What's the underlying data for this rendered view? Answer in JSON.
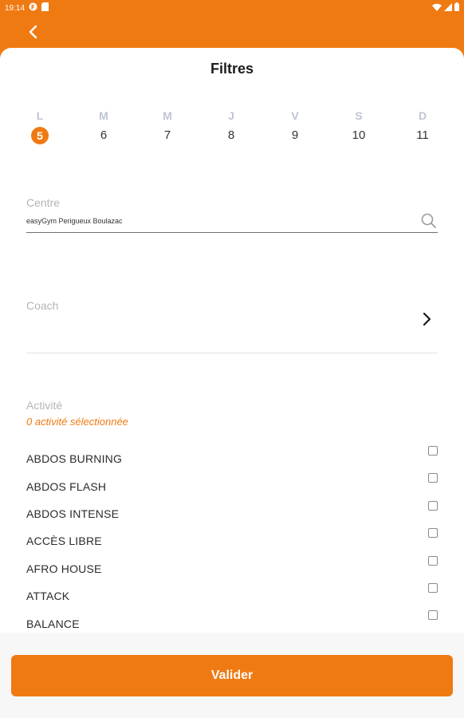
{
  "status_bar": {
    "time": "19:14",
    "left_icons": [
      "app-notification-icon",
      "sd-card-icon"
    ],
    "right_icons": [
      "wifi-icon",
      "signal-icon",
      "battery-icon"
    ]
  },
  "app_bar": {
    "back_icon": "chevron-left-icon"
  },
  "filters": {
    "title": "Filtres",
    "days": [
      {
        "letter": "L",
        "number": "5",
        "selected": true
      },
      {
        "letter": "M",
        "number": "6",
        "selected": false
      },
      {
        "letter": "M",
        "number": "7",
        "selected": false
      },
      {
        "letter": "J",
        "number": "8",
        "selected": false
      },
      {
        "letter": "V",
        "number": "9",
        "selected": false
      },
      {
        "letter": "S",
        "number": "10",
        "selected": false
      },
      {
        "letter": "D",
        "number": "11",
        "selected": false
      }
    ],
    "centre": {
      "label": "Centre",
      "value": "easyGym Perigueux Boulazac",
      "icon": "search-icon"
    },
    "coach": {
      "label": "Coach",
      "icon": "chevron-right-icon"
    },
    "activity": {
      "label": "Activité",
      "count_text": "0 activité sélectionnée",
      "items": [
        {
          "name": "ABDOS BURNING",
          "checked": false
        },
        {
          "name": "ABDOS FLASH",
          "checked": false
        },
        {
          "name": "ABDOS INTENSE",
          "checked": false
        },
        {
          "name": "ACCÈS LIBRE",
          "checked": false
        },
        {
          "name": "AFRO HOUSE",
          "checked": false
        },
        {
          "name": "ATTACK",
          "checked": false
        },
        {
          "name": "BALANCE",
          "checked": false
        }
      ]
    }
  },
  "validate_button": {
    "label": "Valider"
  },
  "colors": {
    "accent": "#F07A12",
    "muted_label": "#B5B5B5",
    "day_letter": "#BFC5D2"
  }
}
